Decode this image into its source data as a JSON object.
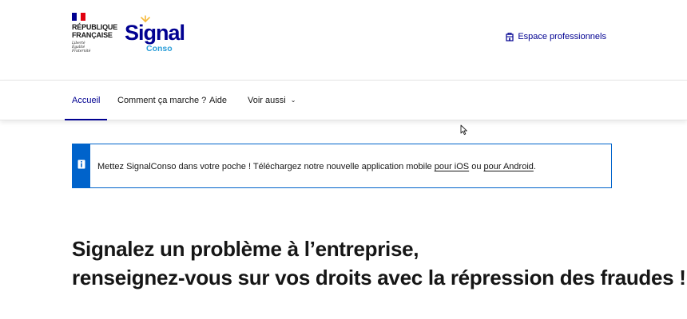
{
  "gov": {
    "name_line1": "RÉPUBLIQUE",
    "name_line2": "FRANÇAISE",
    "motto": [
      "Liberté",
      "Égalité",
      "Fraternité"
    ],
    "flag_colors": [
      "#000091",
      "#ffffff",
      "#e1000f"
    ]
  },
  "logo": {
    "main": "Signal",
    "sub": "Conso"
  },
  "header": {
    "pro_link": "Espace professionnels",
    "pro_icon": "building-icon"
  },
  "nav": {
    "items": [
      {
        "label": "Accueil",
        "active": true
      },
      {
        "label": "Comment ça marche ?"
      },
      {
        "label": "Aide"
      },
      {
        "label": "Voir aussi"
      }
    ]
  },
  "notice": {
    "icon": "info-icon",
    "text_before": "Mettez SignalConso dans votre poche ! Téléchargez notre nouvelle application mobile ",
    "link_ios": "pour iOS",
    "text_middle": " ou ",
    "link_android": "pour Android",
    "text_after": "."
  },
  "hero": {
    "line1": "Signalez un problème à l’entreprise,",
    "line2": "renseignez-vous sur vos droits avec la répression des fraudes !"
  },
  "colors": {
    "primary": "#000091",
    "info": "#0063cb",
    "logo_accent": "#2d9fd9",
    "text": "#161616"
  }
}
